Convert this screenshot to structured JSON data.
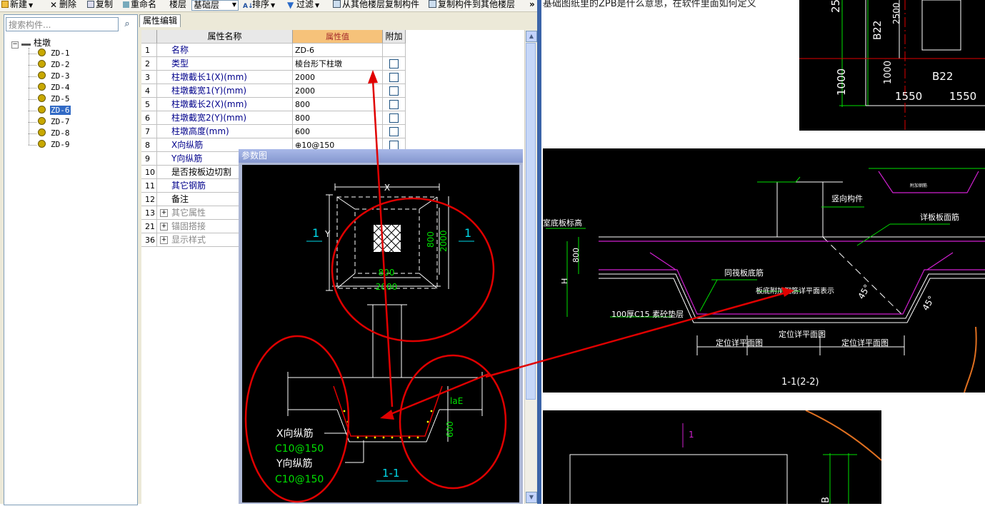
{
  "toolbar": {
    "new": "新建",
    "delete": "删除",
    "copy": "复制",
    "rename": "重命名",
    "floor_label": "楼层",
    "floor_value": "基础层",
    "sort": "排序",
    "filter": "过滤",
    "copy_from_floor": "从其他楼层复制构件",
    "copy_to_floor": "复制构件到其他楼层",
    "more": "»"
  },
  "search": {
    "placeholder": "搜索构件..."
  },
  "tree": {
    "root": "柱墩",
    "items": [
      "ZD-1",
      "ZD-2",
      "ZD-3",
      "ZD-4",
      "ZD-5",
      "ZD-6",
      "ZD-7",
      "ZD-8",
      "ZD-9"
    ],
    "selected": "ZD-6"
  },
  "panel": {
    "tab": "属性编辑",
    "headers": {
      "name": "属性名称",
      "value": "属性值",
      "add": "附加"
    },
    "rows": [
      {
        "no": "1",
        "name": "名称",
        "value": "ZD-6"
      },
      {
        "no": "2",
        "name": "类型",
        "value": "棱台形下柱墩"
      },
      {
        "no": "3",
        "name": "柱墩截长1(X)(mm)",
        "value": "2000"
      },
      {
        "no": "4",
        "name": "柱墩截宽1(Y)(mm)",
        "value": "2000"
      },
      {
        "no": "5",
        "name": "柱墩截长2(X)(mm)",
        "value": "800"
      },
      {
        "no": "6",
        "name": "柱墩截宽2(Y)(mm)",
        "value": "800"
      },
      {
        "no": "7",
        "name": "柱墩高度(mm)",
        "value": "600"
      },
      {
        "no": "8",
        "name": "X向纵筋",
        "value": "⊕10@150"
      },
      {
        "no": "9",
        "name": "Y向纵筋",
        "value": ""
      },
      {
        "no": "10",
        "name": "是否按板边切割",
        "value": ""
      },
      {
        "no": "11",
        "name": "其它钢筋",
        "value": ""
      },
      {
        "no": "12",
        "name": "备注",
        "value": ""
      },
      {
        "no": "13",
        "name": "其它属性",
        "value": ""
      },
      {
        "no": "21",
        "name": "锚固搭接",
        "value": ""
      },
      {
        "no": "36",
        "name": "显示样式",
        "value": ""
      }
    ]
  },
  "param_dialog": {
    "title": "参数图",
    "labels": {
      "x": "X",
      "y": "Y",
      "one_left": "1",
      "one_right": "1",
      "dim_800_v": "800",
      "dim_2000_v": "2000",
      "dim_800_h": "800",
      "dim_2000_h": "2000",
      "lae": "laE",
      "h600": "600",
      "xbar": "X向纵筋",
      "xbar_spec": "C10@150",
      "ybar": "Y向纵筋",
      "ybar_spec": "C10@150",
      "section": "1-1"
    }
  },
  "question_text": "基础图纸里的ZPB是什么意思，在软件里面如何定义",
  "cad1": {
    "t1": "25",
    "t2": "2500",
    "t3": "B22",
    "t4": "1000",
    "t5": "1000",
    "t6": "B22",
    "t7": "1550",
    "t8": "1550"
  },
  "cad2": {
    "label_vertical": "竖向构件",
    "label_slab": "详板板面筋",
    "label_floor_elev": "室底板标高",
    "dim800": "800",
    "label_H": "H",
    "label_same": "同筏板底筋",
    "label_plan": "板底附加钢筋详平面表示",
    "angle1": "45°",
    "angle2": "45°",
    "label_c15": "100厚C15 素砼垫层",
    "label_pos1": "定位详平面图",
    "label_pos2": "定位详平面图",
    "label_pos3": "定位详平面图",
    "label_section": "1-1(2-2)",
    "label_small": "附加钢筋"
  },
  "cad3": {
    "label_1": "1",
    "label_B": "B"
  },
  "colors": {
    "accent_blue": "#316ac5",
    "annotation_red": "#e00000",
    "cad_green": "#00e000",
    "cad_magenta": "#d020d0",
    "cad_cyan": "#00d8e8"
  }
}
